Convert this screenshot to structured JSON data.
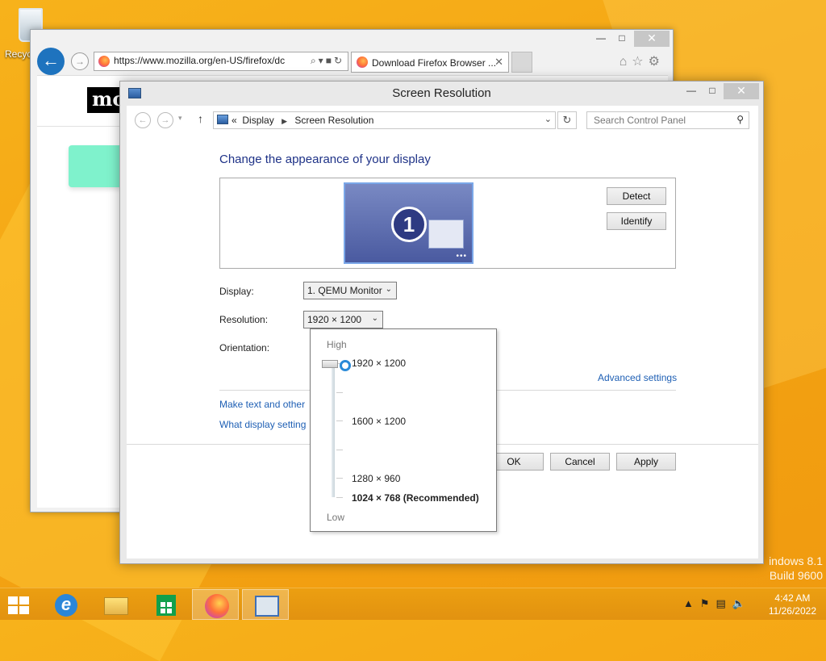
{
  "desktop": {
    "recycle_label": "Recyc"
  },
  "browser": {
    "url": "https://www.mozilla.org/en-US/firefox/dc",
    "tab_title": "Download Firefox Browser ...",
    "logo_text": "mo"
  },
  "dialog": {
    "title": "Screen Resolution",
    "breadcrumb": {
      "prefix": "«",
      "part1": "Display",
      "part2": "Screen Resolution"
    },
    "search_placeholder": "Search Control Panel",
    "heading": "Change the appearance of your display",
    "monitor_number": "1",
    "detect_label": "Detect",
    "identify_label": "Identify",
    "display_label": "Display:",
    "display_value": "1. QEMU Monitor",
    "resolution_label": "Resolution:",
    "resolution_value": "1920 × 1200",
    "orientation_label": "Orientation:",
    "advanced_link": "Advanced settings",
    "make_text_link": "Make text and other",
    "what_display_link": "What display setting",
    "ok_label": "OK",
    "cancel_label": "Cancel",
    "apply_label": "Apply",
    "dropdown": {
      "high": "High",
      "low": "Low",
      "items": [
        "1920 × 1200",
        "1600 × 1200",
        "1280 × 960",
        "1024 × 768 (Recommended)"
      ]
    }
  },
  "watermark": {
    "line1": "indows 8.1",
    "line2": "Build 9600"
  },
  "taskbar": {
    "time": "4:42 AM",
    "date": "11/26/2022"
  }
}
